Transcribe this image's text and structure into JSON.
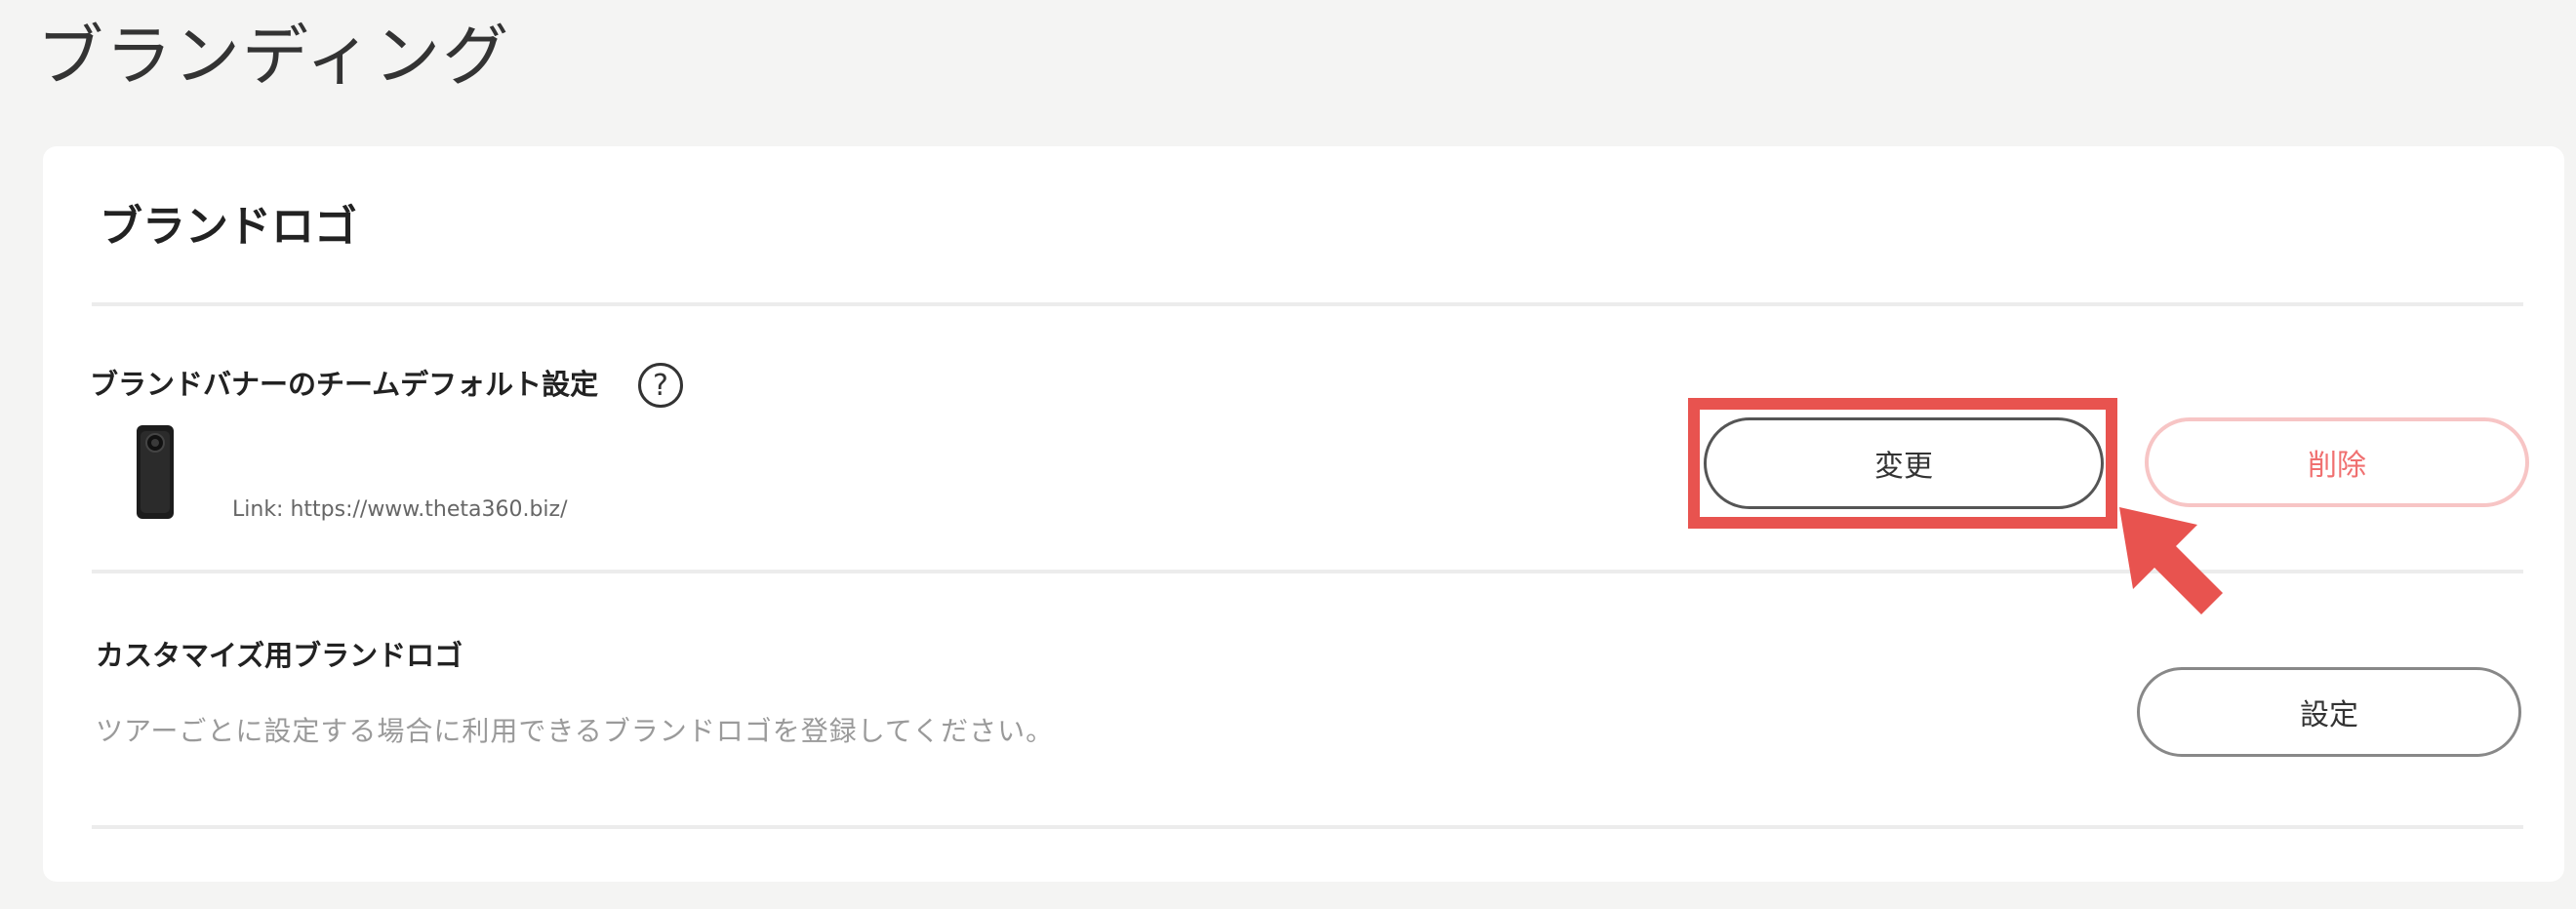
{
  "page": {
    "title": "ブランディング"
  },
  "brand_logo": {
    "card_title": "ブランドロゴ",
    "banner": {
      "label": "ブランドバナーのチームデフォルト設定",
      "help_icon": "question-circle-icon",
      "link_text": "Link: https://www.theta360.biz/",
      "change_label": "変更",
      "delete_label": "削除"
    },
    "custom": {
      "label": "カスタマイズ用ブランドロゴ",
      "description": "ツアーごとに設定する場合に利用できるブランドロゴを登録してください。",
      "setting_label": "設定"
    }
  },
  "annotation": {
    "highlight_color": "#e8534f",
    "arrow_icon": "pointer-arrow-icon"
  },
  "colors": {
    "background": "#f4f4f3",
    "card": "#ffffff",
    "delete_text": "#f07070",
    "delete_border": "#f7c5c5"
  }
}
